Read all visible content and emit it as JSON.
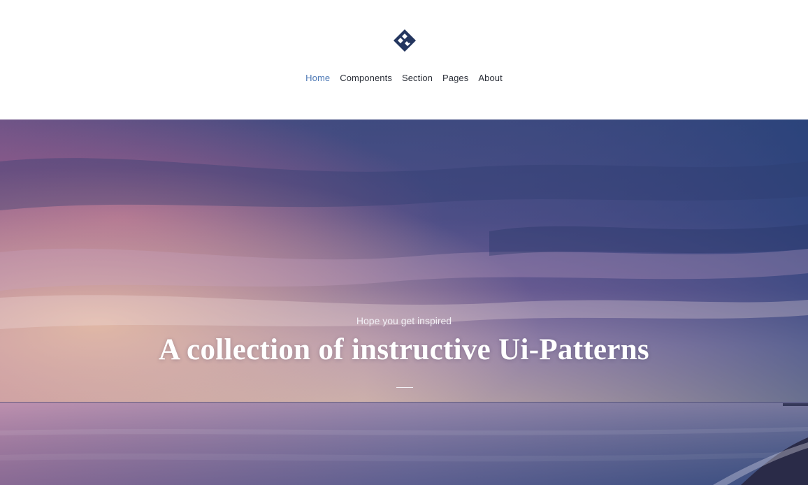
{
  "logo": {
    "icon": "diamond-logo-icon",
    "color": "#24365f"
  },
  "nav": {
    "active_color": "#4c78b5",
    "items": [
      {
        "label": "Home",
        "active": true
      },
      {
        "label": "Components",
        "active": false
      },
      {
        "label": "Section",
        "active": false
      },
      {
        "label": "Pages",
        "active": false
      },
      {
        "label": "About",
        "active": false
      }
    ]
  },
  "hero": {
    "subtitle": "Hope you get inspired",
    "title": "A collection of instructive Ui-Patterns",
    "background": "sunset-over-sea-image"
  }
}
